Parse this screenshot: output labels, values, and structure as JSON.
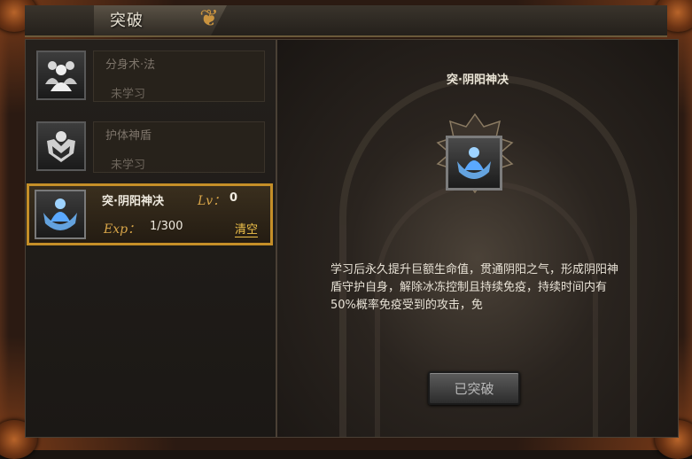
{
  "window": {
    "title": "突破"
  },
  "skills": [
    {
      "name": "分身术·法",
      "status": "未学习",
      "icon": "clone-figures-icon"
    },
    {
      "name": "护体神盾",
      "status": "未学习",
      "icon": "shield-armor-icon"
    }
  ],
  "active_skill": {
    "name": "突·阴阳神决",
    "lv_label": "Lv：",
    "lv_value": "0",
    "exp_label": "Exp：",
    "exp_value": "1/300",
    "clear_label": "清空",
    "icon": "blue-shield-figure-icon"
  },
  "detail": {
    "title": "突·阴阳神决",
    "description": "学习后永久提升巨额生命值，贯通阴阳之气，形成阴阳神盾守护自身，解除冰冻控制且持续免疫，持续时间内有50%概率免疫受到的攻击，免",
    "button_label": "已突破"
  },
  "colors": {
    "accent_gold": "#c58f28",
    "label_gold": "#d9a649",
    "clear_yellow": "#f0c24a"
  }
}
